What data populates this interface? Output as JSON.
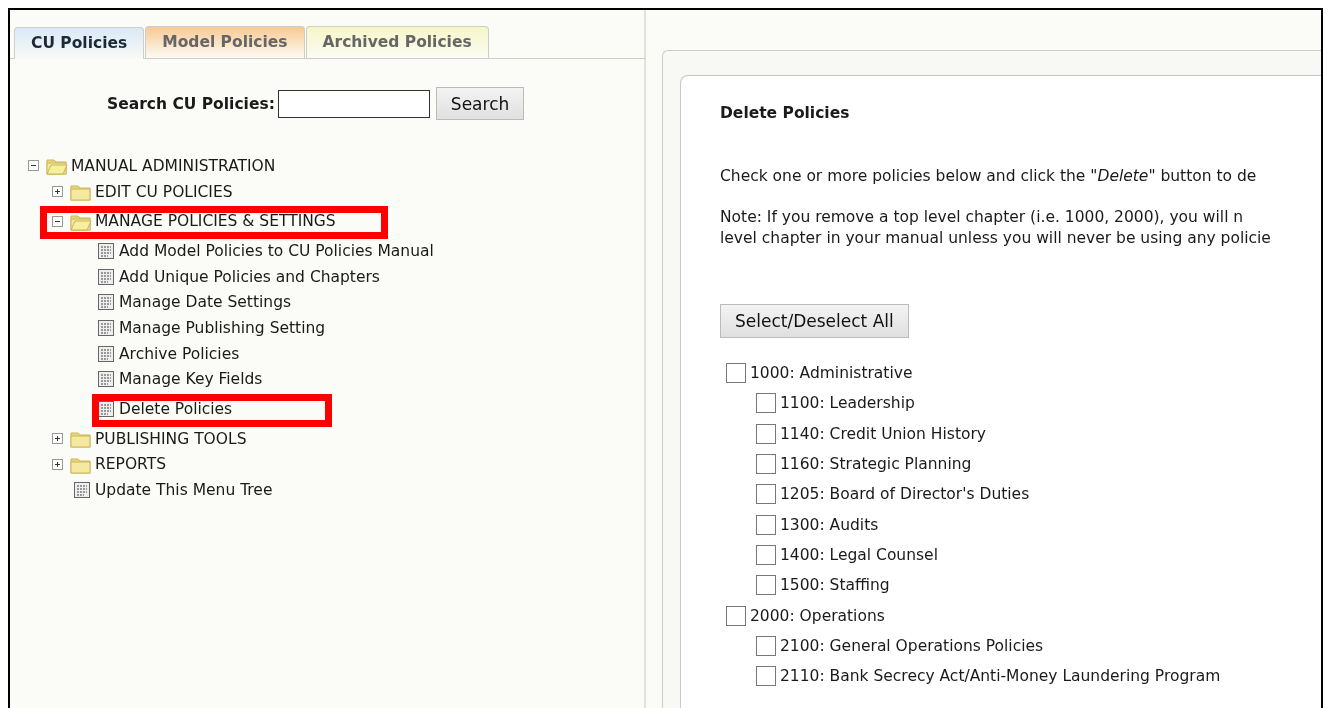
{
  "tabs": [
    {
      "label": "CU Policies",
      "selected": true,
      "color": "#d9e9f7"
    },
    {
      "label": "Model Policies",
      "selected": false,
      "color": "#f8c993"
    },
    {
      "label": "Archived Policies",
      "selected": false,
      "color": "#f6f6c8"
    }
  ],
  "search": {
    "label": "Search CU Policies:",
    "button": "Search"
  },
  "tree": [
    {
      "label": "MANUAL ADMINISTRATION",
      "kind": "folder",
      "expanded": true,
      "children": [
        {
          "label": "EDIT CU POLICIES",
          "kind": "folder",
          "expanded": false
        },
        {
          "label": "MANAGE POLICIES & SETTINGS",
          "kind": "folder",
          "expanded": true,
          "highlighted": true,
          "children": [
            {
              "label": "Add Model Policies to CU Policies Manual",
              "kind": "page"
            },
            {
              "label": "Add Unique Policies and Chapters",
              "kind": "page"
            },
            {
              "label": "Manage Date Settings",
              "kind": "page"
            },
            {
              "label": "Manage Publishing Setting",
              "kind": "page"
            },
            {
              "label": "Archive Policies",
              "kind": "page"
            },
            {
              "label": "Manage Key Fields",
              "kind": "page"
            },
            {
              "label": "Delete Policies",
              "kind": "page",
              "highlighted": true
            }
          ]
        },
        {
          "label": "PUBLISHING TOOLS",
          "kind": "folder",
          "expanded": false
        },
        {
          "label": "REPORTS",
          "kind": "folder",
          "expanded": false
        },
        {
          "label": "Update This Menu Tree",
          "kind": "page"
        }
      ]
    }
  ],
  "content": {
    "title": "Delete Policies",
    "lines": [
      "Check one or more policies below and click the \"*Delete*\" button to de",
      "Note: If you remove a top level chapter (i.e. 1000, 2000), you will n",
      "level chapter in your manual unless you will never be using any policie"
    ],
    "select_all_button": "Select/Deselect All",
    "policies": [
      {
        "label": "1000: Administrative",
        "checked": false,
        "children": [
          {
            "label": "1100: Leadership",
            "checked": false
          },
          {
            "label": "1140: Credit Union History",
            "checked": false
          },
          {
            "label": "1160: Strategic Planning",
            "checked": false
          },
          {
            "label": "1205: Board of Director's Duties",
            "checked": false
          },
          {
            "label": "1300: Audits",
            "checked": false
          },
          {
            "label": "1400: Legal Counsel",
            "checked": false
          },
          {
            "label": "1500: Staffing",
            "checked": false
          }
        ]
      },
      {
        "label": "2000: Operations",
        "checked": false,
        "children": [
          {
            "label": "2100: General Operations Policies",
            "checked": false
          },
          {
            "label": "2110: Bank Secrecy Act/Anti-Money Laundering Program",
            "checked": false
          }
        ]
      }
    ]
  }
}
